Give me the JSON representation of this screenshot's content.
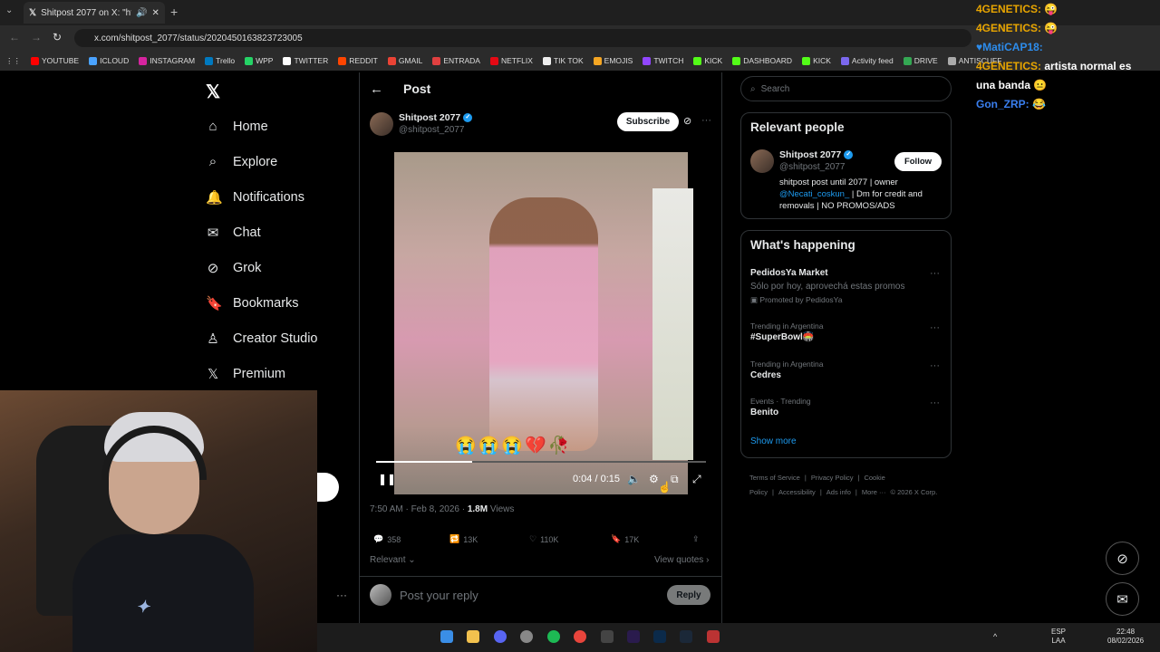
{
  "browser": {
    "tab_title": "Shitpost 2077 on X: \"https:/",
    "url": "x.com/shitpost_2077/status/2020450163823723005",
    "bookmarks": [
      {
        "label": "YOUTUBE",
        "color": "#ff0000"
      },
      {
        "label": "ICLOUD",
        "color": "#4aa3ff"
      },
      {
        "label": "INSTAGRAM",
        "color": "#d6249f"
      },
      {
        "label": "Trello",
        "color": "#0079bf"
      },
      {
        "label": "WPP",
        "color": "#25d366"
      },
      {
        "label": "TWITTER",
        "color": "#ffffff"
      },
      {
        "label": "REDDIT",
        "color": "#ff4500"
      },
      {
        "label": "GMAIL",
        "color": "#ea4335"
      },
      {
        "label": "ENTRADA",
        "color": "#e04040"
      },
      {
        "label": "NETFLIX",
        "color": "#e50914"
      },
      {
        "label": "TIK TOK",
        "color": "#eeeeee"
      },
      {
        "label": "EMOJIS",
        "color": "#f5a623"
      },
      {
        "label": "TWITCH",
        "color": "#9146ff"
      },
      {
        "label": "KICK",
        "color": "#53fc18"
      },
      {
        "label": "DASHBOARD",
        "color": "#53fc18"
      },
      {
        "label": "KICK",
        "color": "#53fc18"
      },
      {
        "label": "Activity feed",
        "color": "#7b68ee"
      },
      {
        "label": "DRIVE",
        "color": "#34a853"
      },
      {
        "label": "ANTISCUFF",
        "color": "#aaaaaa"
      }
    ]
  },
  "nav": {
    "items": [
      {
        "label": "Home",
        "icon": "⌂"
      },
      {
        "label": "Explore",
        "icon": "⌕"
      },
      {
        "label": "Notifications",
        "icon": "🔔"
      },
      {
        "label": "Chat",
        "icon": "✉"
      },
      {
        "label": "Grok",
        "icon": "⊘"
      },
      {
        "label": "Bookmarks",
        "icon": "🔖"
      },
      {
        "label": "Creator Studio",
        "icon": "♙"
      },
      {
        "label": "Premium",
        "icon": "𝕏"
      }
    ]
  },
  "post": {
    "header": "Post",
    "author_name": "Shitpost 2077",
    "author_handle": "@shitpost_2077",
    "subscribe_label": "Subscribe",
    "video": {
      "emojis": "😭😭😭💔🥀",
      "time": "0:04 / 0:15",
      "progress": 0.29
    },
    "timestamp": "7:50 AM · Feb 8, 2026 · ",
    "views_count": "1.8M",
    "views_label": " Views",
    "stats": {
      "replies": "358",
      "reposts": "13K",
      "likes": "110K",
      "bookmarks": "17K"
    },
    "relevant_label": "Relevant ⌄",
    "view_quotes_label": "View quotes ›",
    "reply_placeholder": "Post your reply",
    "reply_button": "Reply"
  },
  "sidebar": {
    "search_placeholder": "Search",
    "relevant_people_title": "Relevant people",
    "person": {
      "name": "Shitpost 2077",
      "handle": "@shitpost_2077",
      "follow_label": "Follow",
      "bio_1": "shitpost post until 2077 | owner",
      "bio_link": "@Necati_coskun_",
      "bio_2": " | Dm for credit and removals | NO PROMOS/ADS"
    },
    "whats_happening_title": "What's happening",
    "trends": [
      {
        "meta": "",
        "name": "PedidosYa Market",
        "sub": "Sólo por hoy, aprovechá estas promos",
        "promo": "Promoted by PedidosYa"
      },
      {
        "meta": "Trending in Argentina",
        "name": "#SuperBowl🏟️"
      },
      {
        "meta": "Trending in Argentina",
        "name": "Cedres"
      },
      {
        "meta": "Events · Trending",
        "name": "Benito"
      }
    ],
    "show_more": "Show more",
    "footer": [
      "Terms of Service",
      "|",
      "Privacy Policy",
      "|",
      "Cookie Policy",
      "|",
      "Accessibility",
      "|",
      "Ads info",
      "|",
      "More ···",
      "© 2026 X Corp."
    ]
  },
  "chat_overlay": [
    {
      "user": "4GENETICS:",
      "msg": "😜",
      "ucolor": "u"
    },
    {
      "user": "4GENETICS:",
      "msg": "😜",
      "ucolor": "u"
    },
    {
      "user": "♥MatiCAP18:",
      "msg": "",
      "ucolor": "u2"
    },
    {
      "user": "4GENETICS:",
      "msg": " artista normal es",
      "ucolor": "u"
    },
    {
      "user": "",
      "msg": "una banda 😐",
      "ucolor": "u"
    },
    {
      "user": "Gon_ZRP:",
      "msg": "😂",
      "ucolor": "u3"
    }
  ],
  "taskbar": {
    "lang_1": "ESP",
    "lang_2": "LAA",
    "time": "22:48",
    "date": "08/02/2026"
  }
}
